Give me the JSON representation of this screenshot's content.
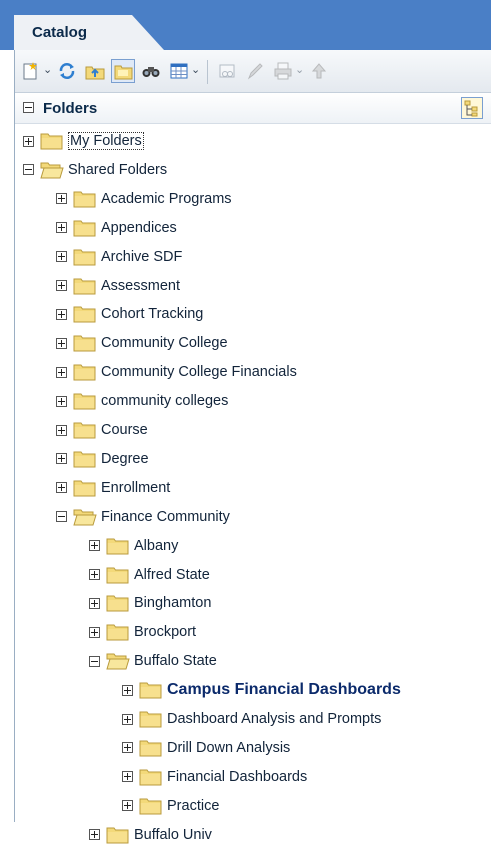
{
  "catalog_tab": {
    "label": "Catalog"
  },
  "toolbar": {
    "buttons": [
      {
        "name": "new-icon"
      },
      {
        "name": "refresh-icon"
      },
      {
        "name": "upload-icon"
      },
      {
        "name": "folder-view-icon"
      },
      {
        "name": "search-icon"
      },
      {
        "name": "grid-icon"
      },
      {
        "name": "properties-icon"
      },
      {
        "name": "edit-icon"
      },
      {
        "name": "print-icon"
      },
      {
        "name": "upload-arrow-icon"
      }
    ]
  },
  "folders_panel": {
    "title": "Folders"
  },
  "tree": [
    {
      "label": "My Folders",
      "level": 0,
      "expanded": false,
      "style": "link"
    },
    {
      "label": "Shared Folders",
      "level": 0,
      "expanded": true,
      "style": "normal"
    },
    {
      "label": "Academic Programs",
      "level": 1,
      "expanded": false,
      "style": "normal"
    },
    {
      "label": "Appendices",
      "level": 1,
      "expanded": false,
      "style": "normal"
    },
    {
      "label": "Archive SDF",
      "level": 1,
      "expanded": false,
      "style": "normal"
    },
    {
      "label": "Assessment",
      "level": 1,
      "expanded": false,
      "style": "normal"
    },
    {
      "label": "Cohort Tracking",
      "level": 1,
      "expanded": false,
      "style": "normal"
    },
    {
      "label": "Community College",
      "level": 1,
      "expanded": false,
      "style": "normal"
    },
    {
      "label": "Community College Financials",
      "level": 1,
      "expanded": false,
      "style": "normal"
    },
    {
      "label": "community colleges",
      "level": 1,
      "expanded": false,
      "style": "normal"
    },
    {
      "label": "Course",
      "level": 1,
      "expanded": false,
      "style": "normal"
    },
    {
      "label": "Degree",
      "level": 1,
      "expanded": false,
      "style": "normal"
    },
    {
      "label": "Enrollment",
      "level": 1,
      "expanded": false,
      "style": "normal"
    },
    {
      "label": "Finance Community",
      "level": 1,
      "expanded": true,
      "style": "normal"
    },
    {
      "label": "Albany",
      "level": 2,
      "expanded": false,
      "style": "normal"
    },
    {
      "label": "Alfred State",
      "level": 2,
      "expanded": false,
      "style": "normal"
    },
    {
      "label": "Binghamton",
      "level": 2,
      "expanded": false,
      "style": "normal"
    },
    {
      "label": "Brockport",
      "level": 2,
      "expanded": false,
      "style": "normal"
    },
    {
      "label": "Buffalo State",
      "level": 2,
      "expanded": true,
      "style": "normal"
    },
    {
      "label": "Campus Financial Dashboards",
      "level": 3,
      "expanded": false,
      "style": "selected"
    },
    {
      "label": "Dashboard Analysis and Prompts",
      "level": 3,
      "expanded": false,
      "style": "normal"
    },
    {
      "label": "Drill Down Analysis",
      "level": 3,
      "expanded": false,
      "style": "normal"
    },
    {
      "label": "Financial Dashboards",
      "level": 3,
      "expanded": false,
      "style": "normal"
    },
    {
      "label": "Practice",
      "level": 3,
      "expanded": false,
      "style": "normal"
    },
    {
      "label": "Buffalo Univ",
      "level": 2,
      "expanded": false,
      "style": "normal"
    }
  ],
  "colors": {
    "tabbar": "#4a7fc6",
    "folder": "#f3d97a",
    "folder_edge": "#b89a3c",
    "selected_text": "#0b2a6b"
  }
}
